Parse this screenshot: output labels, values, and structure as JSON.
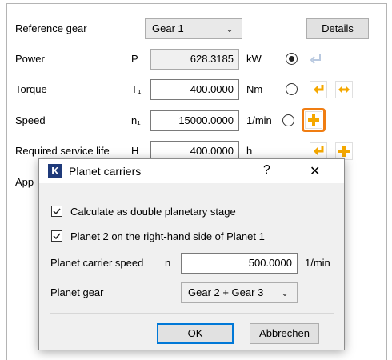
{
  "main": {
    "reference_gear_label": "Reference gear",
    "reference_gear_value": "Gear 1",
    "details_button": "Details",
    "power_label": "Power",
    "power_symbol": "P",
    "power_value": "628.3185",
    "power_unit": "kW",
    "torque_label": "Torque",
    "torque_symbol": "T₁",
    "torque_value": "400.0000",
    "torque_unit": "Nm",
    "speed_label": "Speed",
    "speed_symbol": "n₁",
    "speed_value": "15000.0000",
    "speed_unit": "1/min",
    "service_life_label": "Required service life",
    "service_life_symbol": "H",
    "service_life_value": "400.0000",
    "service_life_unit": "h",
    "app_label_partial": "App"
  },
  "dialog": {
    "app_icon_letter": "K",
    "title": "Planet carriers",
    "help_glyph": "?",
    "close_glyph": "✕",
    "checkbox_double_stage": "Calculate as double planetary stage",
    "checkbox_planet2_right": "Planet 2 on the right-hand side of Planet 1",
    "carrier_speed_label": "Planet carrier speed",
    "carrier_speed_symbol": "n",
    "carrier_speed_value": "500.0000",
    "carrier_speed_unit": "1/min",
    "planet_gear_label": "Planet gear",
    "planet_gear_value": "Gear 2 + Gear 3",
    "ok_button": "OK",
    "cancel_button": "Abbrechen"
  },
  "icons": {
    "chevron": "chevron-down-icon",
    "arrow_left": "arrow-left-yellow-icon",
    "arrow_both": "arrow-left-right-yellow-icon",
    "plus": "plus-yellow-icon",
    "return": "return-arrow-disabled-icon"
  },
  "colors": {
    "highlight": "#f07d12",
    "icon_yellow": "#f5a800",
    "dialog_logo": "#1f3a7a",
    "focus_blue": "#0078d7"
  },
  "state": {
    "selected_radio": "power",
    "double_stage_checked": true,
    "planet2_right_checked": true
  }
}
